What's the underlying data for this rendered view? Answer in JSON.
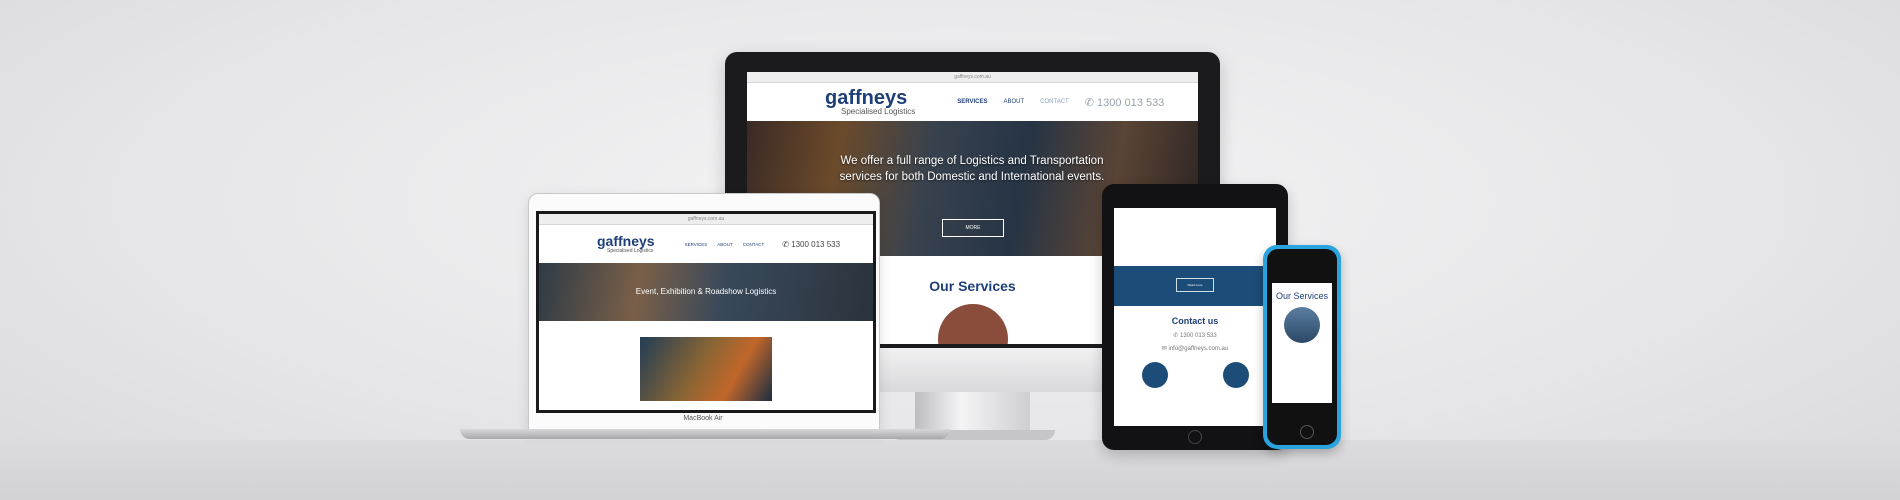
{
  "imac": {
    "url": "gaffneys.com.au",
    "logo_name": "gaffneys",
    "logo_tag": "Specialised Logistics",
    "nav": [
      "SERVICES",
      "ABOUT",
      "CONTACT"
    ],
    "phone": "1300 013 533",
    "hero_text": "We offer a full range of Logistics and Transportation services for both Domestic and International events.",
    "hero_button": "MORE",
    "section_title": "Our Services"
  },
  "macbook": {
    "url": "gaffneys.com.au",
    "logo_name": "gaffneys",
    "logo_tag": "Specialised Logistics",
    "nav": [
      "SERVICES",
      "ABOUT",
      "CONTACT"
    ],
    "phone": "1300 013 533",
    "hero_text": "Event, Exhibition & Roadshow Logistics",
    "label": "MacBook Air"
  },
  "ipad": {
    "band_button": "Read more",
    "contact_title": "Contact us",
    "phone": "1300 013 533",
    "email": "info@gaffneys.com.au"
  },
  "iphone": {
    "title": "Our Services"
  },
  "colors": {
    "brand_blue": "#1e3f78",
    "accent_orange": "#e07b2a",
    "iphone_case": "#2aa3de"
  }
}
